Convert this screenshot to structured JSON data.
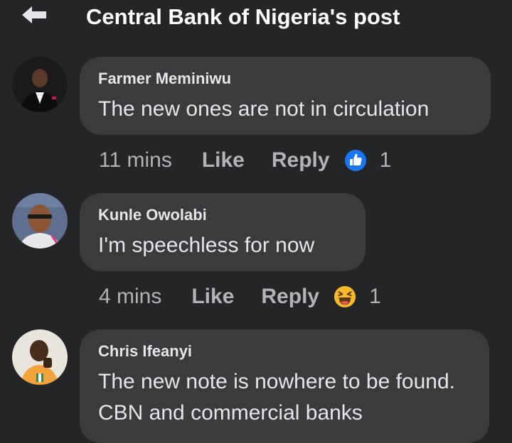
{
  "header": {
    "back_icon": "arrow-left-icon",
    "title": "Central Bank of Nigeria's post"
  },
  "comments": [
    {
      "author": "Farmer Meminiwu",
      "text": "The new ones are not in circulation",
      "time": "11 mins",
      "like_label": "Like",
      "reply_label": "Reply",
      "reaction_icon": "thumbs-up-icon",
      "reaction_count": "1"
    },
    {
      "author": "Kunle Owolabi",
      "text": "I'm speechless for now",
      "time": "4 mins",
      "like_label": "Like",
      "reply_label": "Reply",
      "reaction_icon": "haha-emoji-icon",
      "reaction_count": "1"
    },
    {
      "author": "Chris Ifeanyi",
      "text": "The new note is nowhere to be found. CBN and commercial banks"
    }
  ],
  "colors": {
    "background": "#242526",
    "bubble": "#3a3b3c",
    "text": "#e4e6eb",
    "secondary_text": "#b0b3b8",
    "like_blue": "#1877f2",
    "haha_yellow": "#f7b928"
  }
}
